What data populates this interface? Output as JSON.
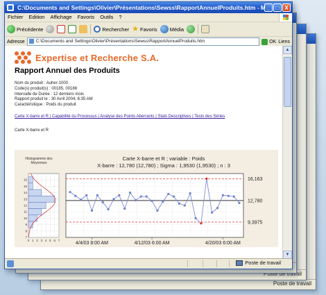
{
  "window": {
    "title": "C:\\Documents and Settings\\Olivier\\Présentations\\Sewss\\RapportAnnuelProduits.htm - Micro...",
    "buttons": {
      "minimize": "_",
      "maximize": "□",
      "close": "X"
    }
  },
  "menu": [
    "Fichier",
    "Edition",
    "Affichage",
    "Favoris",
    "Outils",
    "?"
  ],
  "toolbar": {
    "back_label": "Précédente",
    "search_label": "Rechercher",
    "favorites_label": "Favoris",
    "media_label": "Média"
  },
  "address": {
    "label": "Adresse",
    "value": "C:\\Documents and Settings\\Olivier\\Présentations\\Sewss\\RapportAnnuelProduits.htm",
    "go_label": "OK",
    "links_label": "Liens"
  },
  "page": {
    "company": "Expertise et Recherche S.A.",
    "title": "Rapport Annuel des Produits",
    "meta_lines": [
      "Nom du produit : Auher-1000",
      "Code(s) produit(s) : 00185, 00186",
      "Intervalle de Durée : 12 derniers mois",
      "Rapport produit le : 30 Avril 2004, 6:35 AM",
      "Caractéristique : Poids du produit"
    ],
    "links": "Carte X-barre et R | Capabilité du Processus | Analyse des Points Aberrants | Stats Descriptives | Tests des Séries",
    "section_label": "Carte X-barre et R"
  },
  "chart_data": {
    "type": "line",
    "title": "Carte X-barre et R ; variable : Poids",
    "subtitle": "X-barre : 12,780 (12,780) ; Sigma : 1,9530 (1,9530) ; n : 3",
    "histogram_title": "Histogramme des Moyennes",
    "x_tick_labels": [
      "4/4/03 8:00 AM",
      "4/12/03 6:00 AM",
      "4/20/03 6:00 AM"
    ],
    "y_ticks_hist": [
      "16",
      "15",
      "14",
      "13",
      "12",
      "11",
      "10",
      "9",
      "8",
      "7"
    ],
    "hist_x_ticks": [
      "0",
      "1",
      "2",
      "3",
      "4",
      "5",
      "6",
      "7"
    ],
    "center_line": 12.78,
    "ucl": 16.163,
    "lcl": 9.3975,
    "control_labels": [
      "16,163",
      "12,780",
      "9,3975"
    ],
    "ylim": [
      7,
      17
    ],
    "values": [
      14.1,
      13.5,
      12.9,
      13.6,
      11.2,
      13.6,
      12.5,
      11.4,
      13.0,
      13.6,
      11.5,
      14.0,
      12.8,
      13.4,
      13.4,
      12.7,
      11.2,
      12.6,
      13.8,
      13.4,
      12.3,
      12.0,
      13.9,
      10.0,
      9.2,
      16.2,
      10.9,
      11.6,
      13.6,
      13.5,
      13.4,
      12.4
    ],
    "histogram": [
      {
        "bin": 16,
        "count": 1
      },
      {
        "bin": 15,
        "count": 1
      },
      {
        "bin": 14,
        "count": 3
      },
      {
        "bin": 13,
        "count": 6
      },
      {
        "bin": 12,
        "count": 4
      },
      {
        "bin": 11,
        "count": 3
      },
      {
        "bin": 10,
        "count": 2
      },
      {
        "bin": 9,
        "count": 1
      }
    ]
  },
  "statusbar": {
    "zone_label": "Poste de travail"
  },
  "colors": {
    "accent": "#e8692a",
    "title_bar": "#2059c9",
    "link": "#3a1a9a",
    "chart_line": "#6f7fd0",
    "limit_line": "#e05050"
  }
}
